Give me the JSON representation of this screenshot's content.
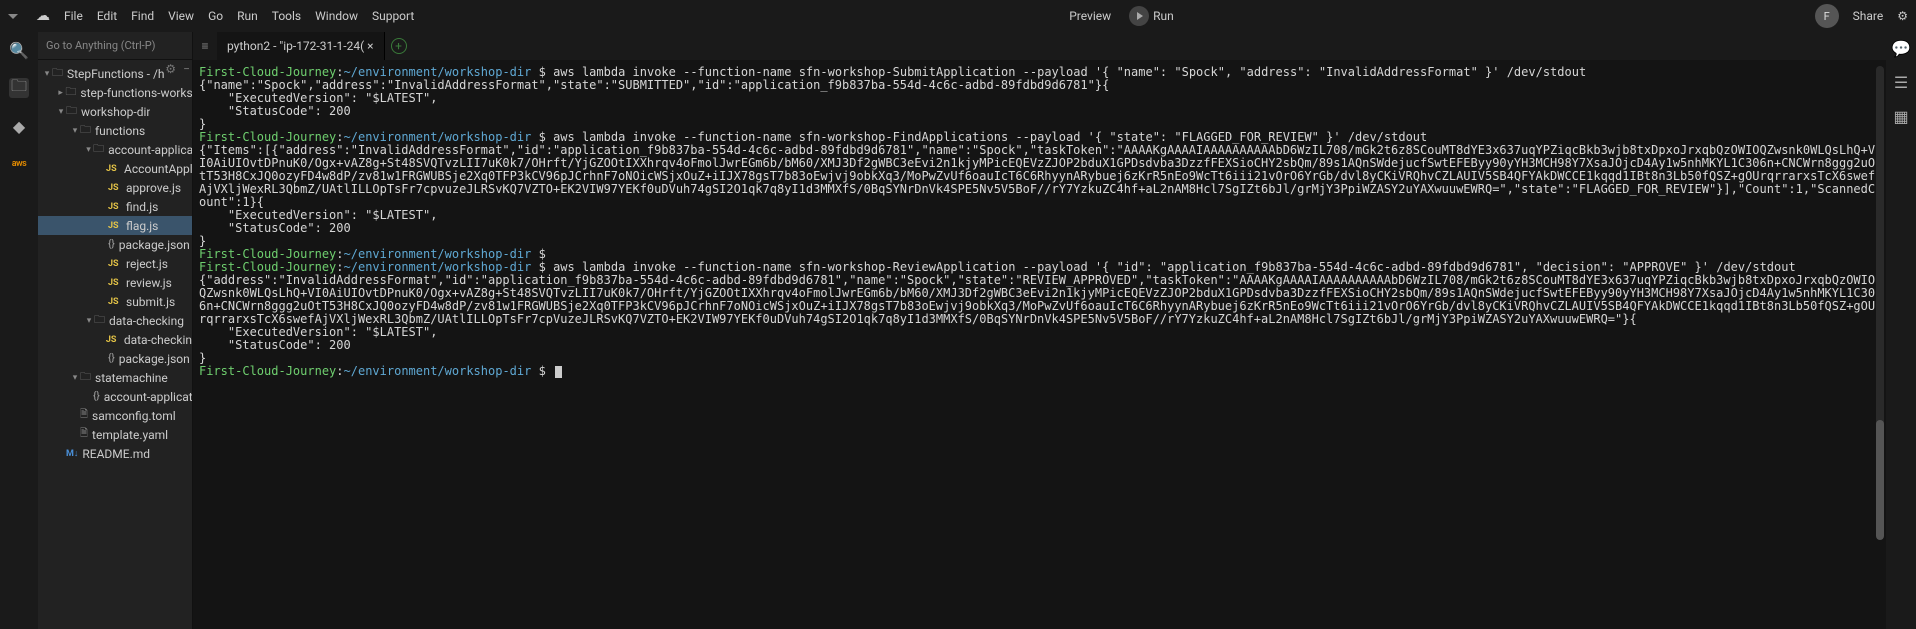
{
  "menu": {
    "items": [
      "File",
      "Edit",
      "Find",
      "View",
      "Go",
      "Run",
      "Tools",
      "Window",
      "Support"
    ],
    "preview": "Preview",
    "run": "Run",
    "share": "Share",
    "avatar_initial": "F"
  },
  "goto_placeholder": "Go to Anything (Ctrl-P)",
  "tree": {
    "root": "StepFunctions - /h",
    "nodes": [
      {
        "depth": 1,
        "type": "folder",
        "tw": "▸",
        "label": "step-functions-worksh"
      },
      {
        "depth": 1,
        "type": "folder",
        "tw": "▾",
        "label": "workshop-dir"
      },
      {
        "depth": 2,
        "type": "folder",
        "tw": "▾",
        "label": "functions"
      },
      {
        "depth": 3,
        "type": "folder",
        "tw": "▾",
        "label": "account-applicati"
      },
      {
        "depth": 4,
        "type": "js",
        "label": "AccountApplica"
      },
      {
        "depth": 4,
        "type": "js",
        "label": "approve.js"
      },
      {
        "depth": 4,
        "type": "js",
        "label": "find.js"
      },
      {
        "depth": 4,
        "type": "js",
        "label": "flag.js",
        "active": true
      },
      {
        "depth": 4,
        "type": "json",
        "label": "package.json"
      },
      {
        "depth": 4,
        "type": "js",
        "label": "reject.js"
      },
      {
        "depth": 4,
        "type": "js",
        "label": "review.js"
      },
      {
        "depth": 4,
        "type": "js",
        "label": "submit.js"
      },
      {
        "depth": 3,
        "type": "folder",
        "tw": "▾",
        "label": "data-checking"
      },
      {
        "depth": 4,
        "type": "js",
        "label": "data-checking.js"
      },
      {
        "depth": 4,
        "type": "json",
        "label": "package.json"
      },
      {
        "depth": 2,
        "type": "folder",
        "tw": "▾",
        "label": "statemachine"
      },
      {
        "depth": 3,
        "type": "json",
        "label": "account-applicatio"
      },
      {
        "depth": 2,
        "type": "yaml",
        "label": "samconfig.toml"
      },
      {
        "depth": 2,
        "type": "yaml",
        "label": "template.yaml"
      },
      {
        "depth": 1,
        "type": "md",
        "label": "README.md"
      }
    ]
  },
  "tab_title": "python2 - \"ip-172-31-1-24( ×",
  "aws_label": "aws",
  "terminal": {
    "prompt_user": "First-Cloud-Journey",
    "prompt_path": "~/environment/workshop-dir",
    "prompt_sym": "$",
    "lines": [
      {
        "t": "prompt",
        "cmd": "aws lambda invoke --function-name sfn-workshop-SubmitApplication --payload '{ \"name\": \"Spock\", \"address\": \"InvalidAddressFormat\" }' /dev/stdout"
      },
      {
        "t": "out",
        "txt": "{\"name\":\"Spock\",\"address\":\"InvalidAddressFormat\",\"state\":\"SUBMITTED\",\"id\":\"application_f9b837ba-554d-4c6c-adbd-89fdbd9d6781\"}{"
      },
      {
        "t": "out",
        "txt": "    \"ExecutedVersion\": \"$LATEST\","
      },
      {
        "t": "out",
        "txt": "    \"StatusCode\": 200"
      },
      {
        "t": "out",
        "txt": "}"
      },
      {
        "t": "prompt",
        "cmd": "aws lambda invoke --function-name sfn-workshop-FindApplications --payload '{ \"state\": \"FLAGGED_FOR_REVIEW\" }' /dev/stdout"
      },
      {
        "t": "out",
        "txt": "{\"Items\":[{\"address\":\"InvalidAddressFormat\",\"id\":\"application_f9b837ba-554d-4c6c-adbd-89fdbd9d6781\",\"name\":\"Spock\",\"taskToken\":\"AAAAKgAAAAIAAAAAAAAAAbD6WzIL708/mGk2t6z8SCouMT8dYE3x637uqYPZiqcBkb3wjb8txDpxoJrxqbQzOWIOQZwsnk0WLQsLhQ+VI0AiUIOvtDPnuK0/Ogx+vAZ8g+St48SVQTvzLII7uK0k7/OHrft/YjGZOOtIXXhrqv4oFmolJwrEGm6b/bM60/XMJ3Df2gWBC3eEvi2n1kjyMPicEQEVzZJOP2bduX1GPDsdvba3DzzfFEXSioCHY2sbQm/89s1AQnSWdejucfSwtEFEByy90yYH3MCH98Y7XsaJOjcD4Ay1w5nhMKYL1C306n+CNCWrn8ggg2uOtT53H8CxJQ0ozyFD4w8dP/zv81w1FRGWUBSje2Xq0TFP3kCV96pJCrhnF7oNOicWSjxOuZ+iIJX78gsT7b83oEwjvj9obkXq3/MoPwZvUf6oauIcT6C6RhyynARybuej6zKrR5nEo9WcTt6iii21vOrO6YrGb/dvl8yCKiVRQhvCZLAUIV5SB4QFYAkDWCCE1kqqd1IBt8n3Lb50fQSZ+gOUrqrrarxsTcX6swefAjVXljWexRL3QbmZ/UAtlILLOpTsFr7cpvuzeJLRSvKQ7VZTO+EK2VIW97YEKf0uDVuh74gSI2O1qk7q8yI1d3MMXfS/0BqSYNrDnVk4SPE5Nv5V5BoF//rY7YzkuZC4hf+aL2nAM8Hcl7SgIZt6bJl/grMjY3PpiWZASY2uYAXwuuwEWRQ=\",\"state\":\"FLAGGED_FOR_REVIEW\"}],\"Count\":1,\"ScannedCount\":1}{"
      },
      {
        "t": "out",
        "txt": "    \"ExecutedVersion\": \"$LATEST\","
      },
      {
        "t": "out",
        "txt": "    \"StatusCode\": 200"
      },
      {
        "t": "out",
        "txt": "}"
      },
      {
        "t": "prompt",
        "cmd": ""
      },
      {
        "t": "prompt",
        "cmd": "aws lambda invoke --function-name sfn-workshop-ReviewApplication --payload '{ \"id\": \"application_f9b837ba-554d-4c6c-adbd-89fdbd9d6781\", \"decision\": \"APPROVE\" }' /dev/stdout"
      },
      {
        "t": "out",
        "txt": "{\"address\":\"InvalidAddressFormat\",\"id\":\"application_f9b837ba-554d-4c6c-adbd-89fdbd9d6781\",\"name\":\"Spock\",\"state\":\"REVIEW_APPROVED\",\"taskToken\":\"AAAAKgAAAAIAAAAAAAAAAbD6WzIL708/mGk2t6z8SCouMT8dYE3x637uqYPZiqcBkb3wjb8txDpxoJrxqbQzOWIOQZwsnk0WLQsLhQ+VI0AiUIOvtDPnuK0/Ogx+vAZ8g+St48SVQTvzLII7uK0k7/OHrft/YjGZOOtIXXhrqv4oFmolJwrEGm6b/bM60/XMJ3Df2gWBC3eEvi2n1kjyMPicEQEVzZJOP2bduX1GPDsdvba3DzzfFEXSioCHY2sbQm/89s1AQnSWdejucfSwtEFEByy90yYH3MCH98Y7XsaJOjcD4Ay1w5nhMKYL1C306n+CNCWrn8ggg2uOtT53H8CxJQ0ozyFD4w8dP/zv81w1FRGWUBSje2Xq0TFP3kCV96pJCrhnF7oNOicWSjxOuZ+iIJX78gsT7b83oEwjvj9obkXq3/MoPwZvUf6oauIcT6C6RhyynARybuej6zKrR5nEo9WcTt6iii21vOrO6YrGb/dvl8yCKiVRQhvCZLAUIV5SB4QFYAkDWCCE1kqqd1IBt8n3Lb50fQSZ+gOUrqrrarxsTcX6swefAjVXljWexRL3QbmZ/UAtlILLOpTsFr7cpVuzeJLRSvKQ7VZTO+EK2VIW97YEKf0uDVuh74gSI2O1qk7q8yI1d3MMXfS/0BqSYNrDnVk4SPE5Nv5V5BoF//rY7YzkuZC4hf+aL2nAM8Hcl7SgIZt6bJl/grMjY3PpiWZASY2uYAXwuuwEWRQ=\"}{"
      },
      {
        "t": "out",
        "txt": "    \"ExecutedVersion\": \"$LATEST\","
      },
      {
        "t": "out",
        "txt": "    \"StatusCode\": 200"
      },
      {
        "t": "out",
        "txt": "}"
      },
      {
        "t": "prompt",
        "cmd": "",
        "cursor": true
      }
    ]
  }
}
